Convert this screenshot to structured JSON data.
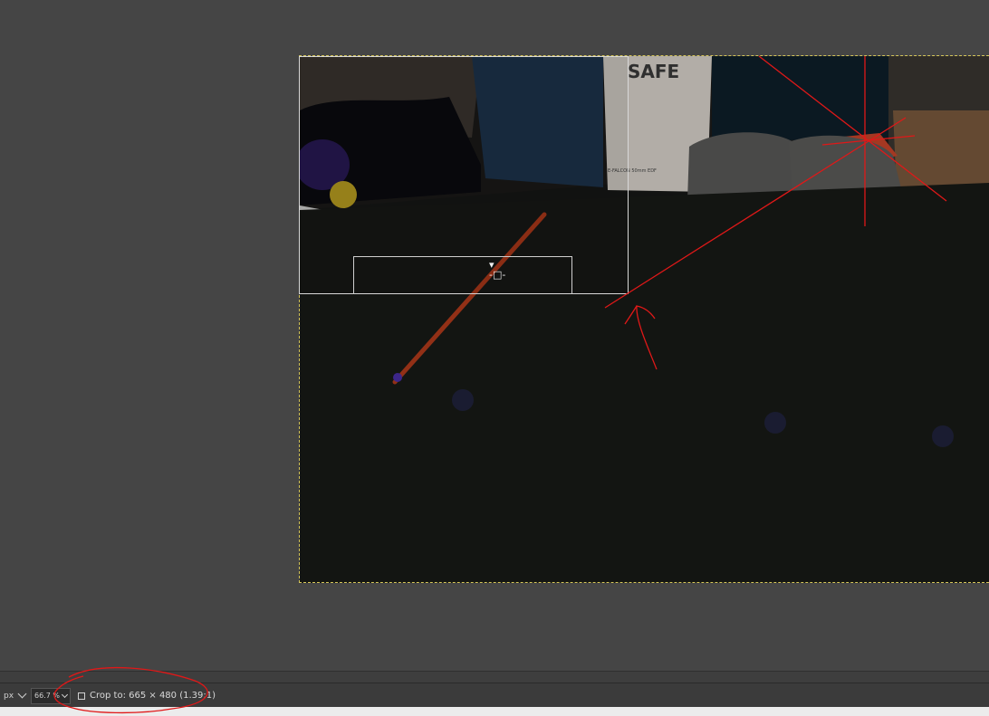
{
  "statusbar": {
    "unit": "px",
    "zoom": "66.7 %",
    "crop_info": "Crop to: 665 × 480  (1.39:1)"
  },
  "canvas": {
    "photo_text": "SAFE",
    "box_text": "E-FALCON 50mm EDF"
  },
  "colors": {
    "canvas_bg": "#454545",
    "annotation_red": "#e01818",
    "image_border": "#d6c65a"
  },
  "icons": {
    "unit_dropdown": "chevron-down-icon",
    "zoom_dropdown": "chevron-down-icon",
    "crop_tool": "crop-icon",
    "cursor": "crop-resize-cursor-icon"
  }
}
